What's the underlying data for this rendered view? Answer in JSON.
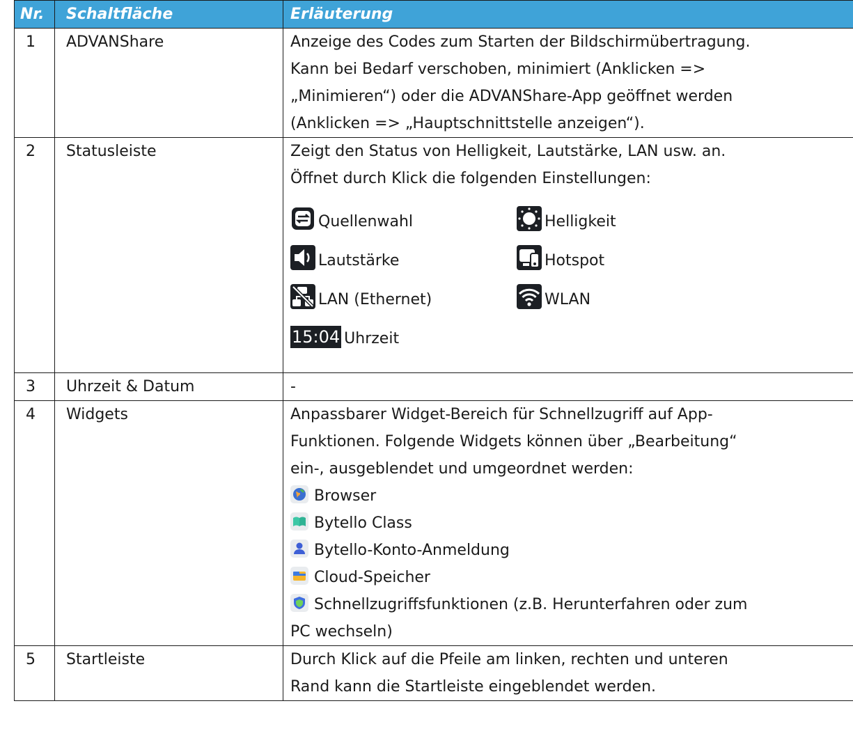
{
  "header": {
    "nr": "Nr.",
    "button": "Schaltfläche",
    "desc": "Erläuterung"
  },
  "rows": [
    {
      "nr": "1",
      "name": "ADVANShare",
      "lines": [
        "Anzeige des Codes zum Starten der Bildschirmübertragung.",
        "Kann bei Bedarf verschoben, minimiert (Anklicken =>",
        "„Minimieren“) oder die ADVANShare-App geöffnet werden",
        "(Anklicken => „Hauptschnittstelle anzeigen“)."
      ]
    },
    {
      "nr": "2",
      "name": "Statusleiste",
      "lines": [
        "Zeigt den Status von Helligkeit, Lautstärke, LAN usw. an.",
        "Öffnet durch Klick die folgenden Einstellungen:"
      ],
      "icons": [
        {
          "icon": "source-select-icon",
          "label": "Quellenwahl"
        },
        {
          "icon": "brightness-icon",
          "label": "Helligkeit"
        },
        {
          "icon": "volume-icon",
          "label": "Lautstärke"
        },
        {
          "icon": "hotspot-icon",
          "label": "Hotspot"
        },
        {
          "icon": "lan-ethernet-icon",
          "label": "LAN (Ethernet)"
        },
        {
          "icon": "wlan-icon",
          "label": "WLAN"
        }
      ],
      "clock": {
        "time": "15:04",
        "label": "Uhrzeit"
      }
    },
    {
      "nr": "3",
      "name": "Uhrzeit & Datum",
      "lines": [
        "-"
      ]
    },
    {
      "nr": "4",
      "name": "Widgets",
      "lines": [
        "Anpassbarer Widget-Bereich für Schnellzugriff auf App-",
        "Funktionen. Folgende Widgets können über „Bearbeitung“",
        "ein-, ausgeblendet und umgeordnet werden:"
      ],
      "widgets": [
        {
          "icon": "browser-icon",
          "label": "Browser"
        },
        {
          "icon": "bytello-class-icon",
          "label": "Bytello Class"
        },
        {
          "icon": "account-login-icon",
          "label": "Bytello-Konto-Anmeldung"
        },
        {
          "icon": "cloud-storage-icon",
          "label": "Cloud-Speicher"
        },
        {
          "icon": "quick-access-icon",
          "label": "Schnellzugriffsfunktionen (z.B. Herunterfahren oder zum"
        }
      ],
      "widget_tail": "PC wechseln)"
    },
    {
      "nr": "5",
      "name": "Startleiste",
      "lines": [
        "Durch Klick auf die Pfeile am linken, rechten und unteren",
        "Rand kann die Startleiste eingeblendet werden."
      ]
    }
  ]
}
